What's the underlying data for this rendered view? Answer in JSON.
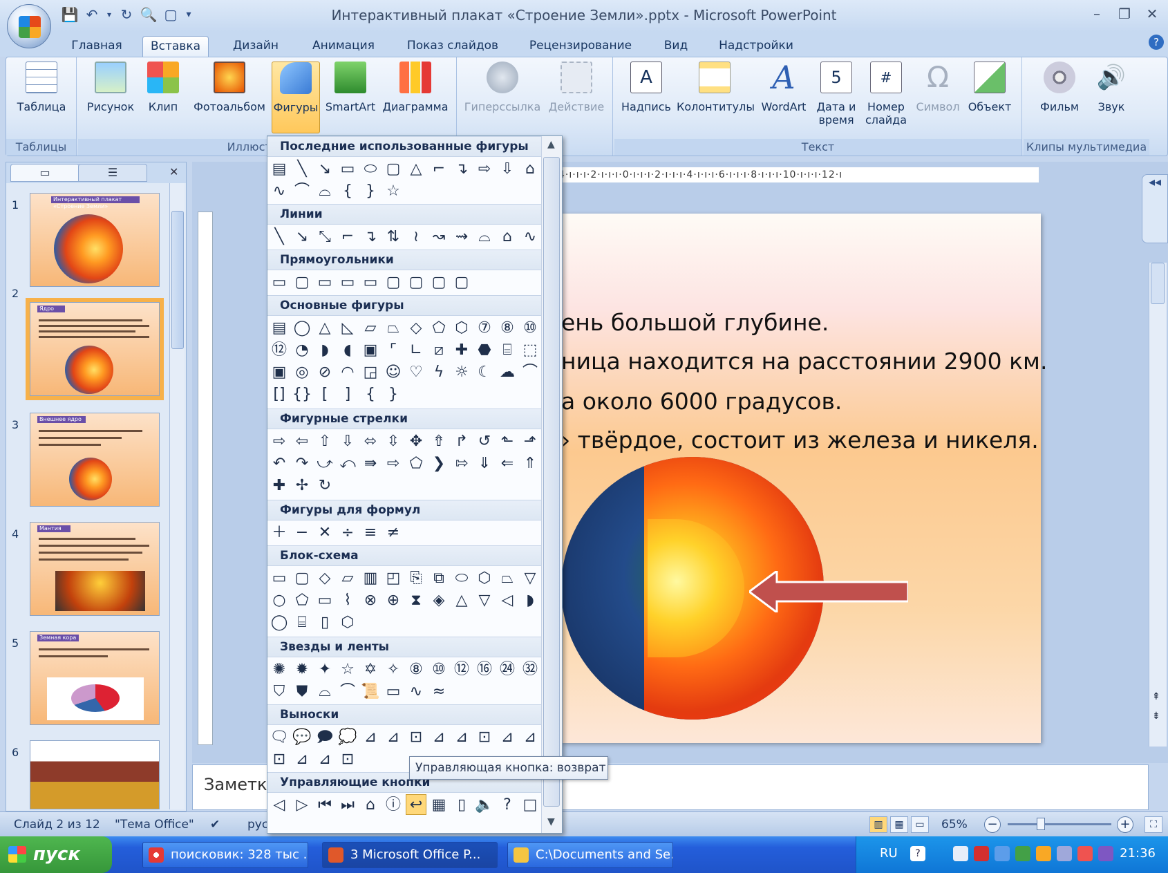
{
  "window": {
    "title": "Интерактивный плакат «Строение Земли».pptx - Microsoft PowerPoint",
    "qat": [
      "save-icon",
      "undo-icon",
      "redo-icon",
      "print-preview-icon",
      "new-icon",
      "customize-icon"
    ],
    "controls": {
      "minimize": "–",
      "restore": "❐",
      "close": "✕"
    }
  },
  "tabs": [
    "Главная",
    "Вставка",
    "Дизайн",
    "Анимация",
    "Показ слайдов",
    "Рецензирование",
    "Вид",
    "Надстройки"
  ],
  "active_tab": "Вставка",
  "ribbon": {
    "groups": {
      "tables": "Таблицы",
      "illustrations": "Иллюстрации",
      "text": "Текст",
      "media": "Клипы мультимедиа"
    },
    "buttons": {
      "table": "Таблица",
      "picture": "Рисунок",
      "clip": "Клип",
      "photo_album": "Фотоальбом",
      "shapes": "Фигуры",
      "smartart": "SmartArt",
      "chart": "Диаграмма",
      "hyperlink": "Гиперссылка",
      "action": "Действие",
      "textbox": "Надпись",
      "header_footer": "Колонтитулы",
      "wordart": "WordArt",
      "date_time_1": "Дата и",
      "date_time_2": "время",
      "slide_number_1": "Номер",
      "slide_number_2": "слайда",
      "symbol": "Символ",
      "object": "Объект",
      "movie": "Фильм",
      "sound": "Звук"
    },
    "illustrations_label_visible": "Иллюст"
  },
  "shapes_menu": {
    "sections": {
      "recent": "Последние использованные фигуры",
      "lines": "Линии",
      "rectangles": "Прямоугольники",
      "basic": "Основные фигуры",
      "arrows": "Фигурные стрелки",
      "equation": "Фигуры для формул",
      "flowchart": "Блок-схема",
      "stars": "Звезды и ленты",
      "callouts": "Выноски",
      "action_buttons": "Управляющие кнопки"
    },
    "tooltip": "Управляющая кнопка: возврат"
  },
  "slide": {
    "bullets": [
      "ень большой глубине.",
      "ница находится на расстоянии 2900 км.",
      "а около 6000 градусов.",
      "› твёрдое, состоит из железа и никеля."
    ]
  },
  "ruler": {
    "horizontal": "4·ı·ı·ı·2·ı·ı·ı·0·ı·ı·ı·2·ı·ı·ı·4·ı·ı·ı·6·ı·ı·ı·8·ı·ı·ı·10·ı·ı·ı·12·ı"
  },
  "thumbnails": [
    {
      "num": "1",
      "title": "Интерактивный плакат «Строение Земли»"
    },
    {
      "num": "2",
      "title": "Ядро"
    },
    {
      "num": "3",
      "title": "Внешнее ядро"
    },
    {
      "num": "4",
      "title": "Мантия"
    },
    {
      "num": "5",
      "title": "Земная кора"
    },
    {
      "num": "6",
      "title": ""
    }
  ],
  "selected_slide": 2,
  "notes": {
    "placeholder": "Заметки"
  },
  "status": {
    "slide": "Слайд 2 из 12",
    "theme": "\"Тема Office\"",
    "lang": "рус",
    "zoom": "65%"
  },
  "taskbar": {
    "start": "пуск",
    "tasks": [
      "поисковик: 328 тыс ...",
      "3 Microsoft Office P...",
      "C:\\Documents and Se..."
    ],
    "lang": "RU",
    "clock": "21:36"
  },
  "colors": {
    "ribbon": "#dfeaf8",
    "selection": "#ffc85b",
    "taskbar": "#245edb",
    "start": "#36973a"
  }
}
